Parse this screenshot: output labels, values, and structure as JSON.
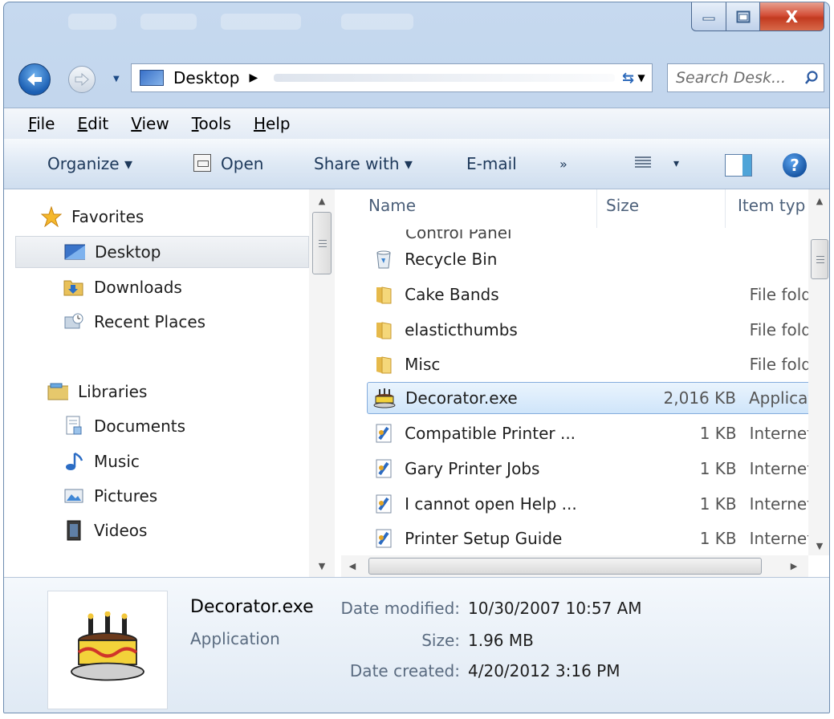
{
  "window": {
    "min_label": "",
    "max_label": "",
    "close_label": "X"
  },
  "address": {
    "location": "Desktop",
    "search_placeholder": "Search Desk..."
  },
  "menubar": {
    "items": [
      {
        "mnemonic": "F",
        "rest": "ile"
      },
      {
        "mnemonic": "E",
        "rest": "dit"
      },
      {
        "mnemonic": "V",
        "rest": "iew"
      },
      {
        "mnemonic": "T",
        "rest": "ools"
      },
      {
        "mnemonic": "H",
        "rest": "elp"
      }
    ]
  },
  "toolbar": {
    "organize": "Organize ▾",
    "open": "Open",
    "share": "Share with ▾",
    "email": "E-mail",
    "more": "»",
    "views_drop": "▾",
    "help": "?"
  },
  "nav": {
    "items": [
      {
        "label": "Favorites",
        "icon": "star-icon"
      },
      {
        "label": "Desktop",
        "icon": "desktop-icon"
      },
      {
        "label": "Downloads",
        "icon": "downloads-folder-icon"
      },
      {
        "label": "Recent Places",
        "icon": "recent-places-icon"
      },
      {
        "label": "Libraries",
        "icon": "libraries-icon"
      },
      {
        "label": "Documents",
        "icon": "documents-icon"
      },
      {
        "label": "Music",
        "icon": "music-icon"
      },
      {
        "label": "Pictures",
        "icon": "pictures-icon"
      },
      {
        "label": "Videos",
        "icon": "videos-icon"
      }
    ]
  },
  "files": {
    "columns": {
      "name": "Name",
      "size": "Size",
      "type": "Item typ"
    },
    "partial_row": "Control Panel",
    "rows": [
      {
        "name": "Recycle Bin",
        "size": "",
        "type": "",
        "icon": "recycle-bin-icon"
      },
      {
        "name": "Cake Bands",
        "size": "",
        "type": "File fold",
        "icon": "folder-icon"
      },
      {
        "name": "elasticthumbs",
        "size": "",
        "type": "File fold",
        "icon": "folder-icon"
      },
      {
        "name": "Misc",
        "size": "",
        "type": "File fold",
        "icon": "folder-icon"
      },
      {
        "name": "Decorator.exe",
        "size": "2,016 KB",
        "type": "Applicat",
        "icon": "cake-icon"
      },
      {
        "name": "Compatible Printer ...",
        "size": "1 KB",
        "type": "Internet",
        "icon": "internet-shortcut-icon"
      },
      {
        "name": "Gary Printer Jobs",
        "size": "1 KB",
        "type": "Internet",
        "icon": "internet-shortcut-icon"
      },
      {
        "name": "I cannot open Help ...",
        "size": "1 KB",
        "type": "Internet",
        "icon": "internet-shortcut-icon"
      },
      {
        "name": "Printer Setup Guide",
        "size": "1 KB",
        "type": "Internet",
        "icon": "internet-shortcut-icon"
      }
    ]
  },
  "details": {
    "name": "Decorator.exe",
    "kind": "Application",
    "modified_label": "Date modified:",
    "modified": "10/30/2007 10:57 AM",
    "size_label": "Size:",
    "size": "1.96 MB",
    "created_label": "Date created:",
    "created": "4/20/2012 3:16 PM"
  },
  "colors": {
    "selection": "#cfe5fa",
    "selection_border": "#84acdd",
    "chrome": "#b8cde6",
    "close": "#c23a20"
  }
}
